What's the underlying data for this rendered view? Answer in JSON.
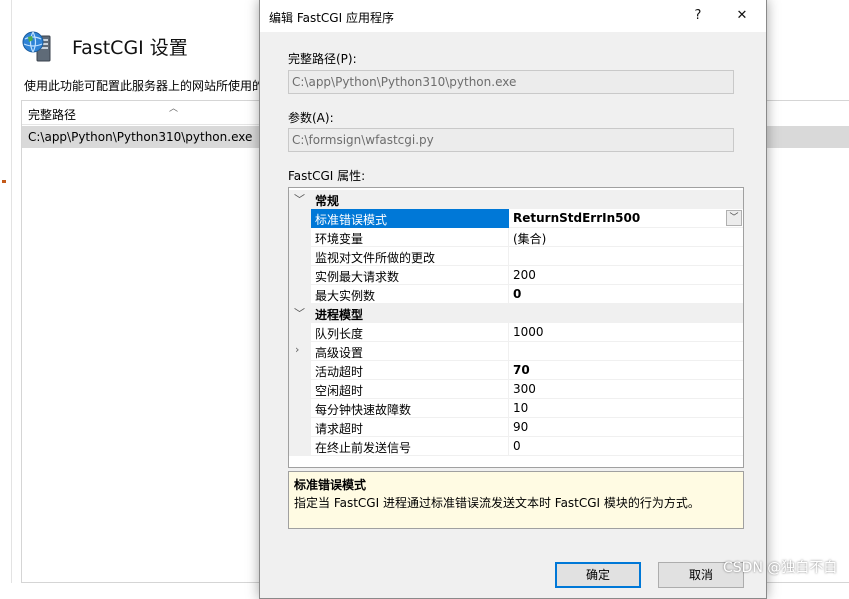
{
  "background": {
    "page_title": "FastCGI 设置",
    "description": "使用此功能可配置此服务器上的网站所使用的",
    "grid": {
      "column_header": "完整路径",
      "rows": [
        "C:\\app\\Python\\Python310\\python.exe"
      ]
    }
  },
  "dialog": {
    "title": "编辑 FastCGI 应用程序",
    "help_label": "?",
    "close_label": "✕",
    "full_path_label": "完整路径(P):",
    "full_path_value": "C:\\app\\Python\\Python310\\python.exe",
    "arguments_label": "参数(A):",
    "arguments_value": "C:\\formsign\\wfastcgi.py",
    "properties_label": "FastCGI 属性:",
    "categories": {
      "general": "常规",
      "process_model": "进程模型"
    },
    "properties": {
      "stderr_mode": {
        "name": "标准错误模式",
        "value": "ReturnStdErrIn500"
      },
      "env_vars": {
        "name": "环境变量",
        "value": "(集合)"
      },
      "monitor_changes": {
        "name": "监视对文件所做的更改",
        "value": ""
      },
      "max_requests": {
        "name": "实例最大请求数",
        "value": "200"
      },
      "max_instances": {
        "name": "最大实例数",
        "value": "0"
      },
      "queue_length": {
        "name": "队列长度",
        "value": "1000"
      },
      "advanced": {
        "name": "高级设置",
        "value": ""
      },
      "activity_timeout": {
        "name": "活动超时",
        "value": "70"
      },
      "idle_timeout": {
        "name": "空闲超时",
        "value": "300"
      },
      "rapid_fails": {
        "name": "每分钟快速故障数",
        "value": "10"
      },
      "request_timeout": {
        "name": "请求超时",
        "value": "90"
      },
      "signal_before_terminate": {
        "name": "在终止前发送信号",
        "value": "0"
      }
    },
    "description_panel": {
      "title": "标准错误模式",
      "text": "指定当 FastCGI 进程通过标准错误流发送文本时 FastCGI 模块的行为方式。"
    },
    "ok_label": "确定",
    "cancel_label": "取消"
  },
  "watermark": "CSDN @独白不白",
  "colors": {
    "selection": "#0078d7",
    "description_bg": "#fffbe3",
    "dialog_bg": "#f0f0f0"
  }
}
